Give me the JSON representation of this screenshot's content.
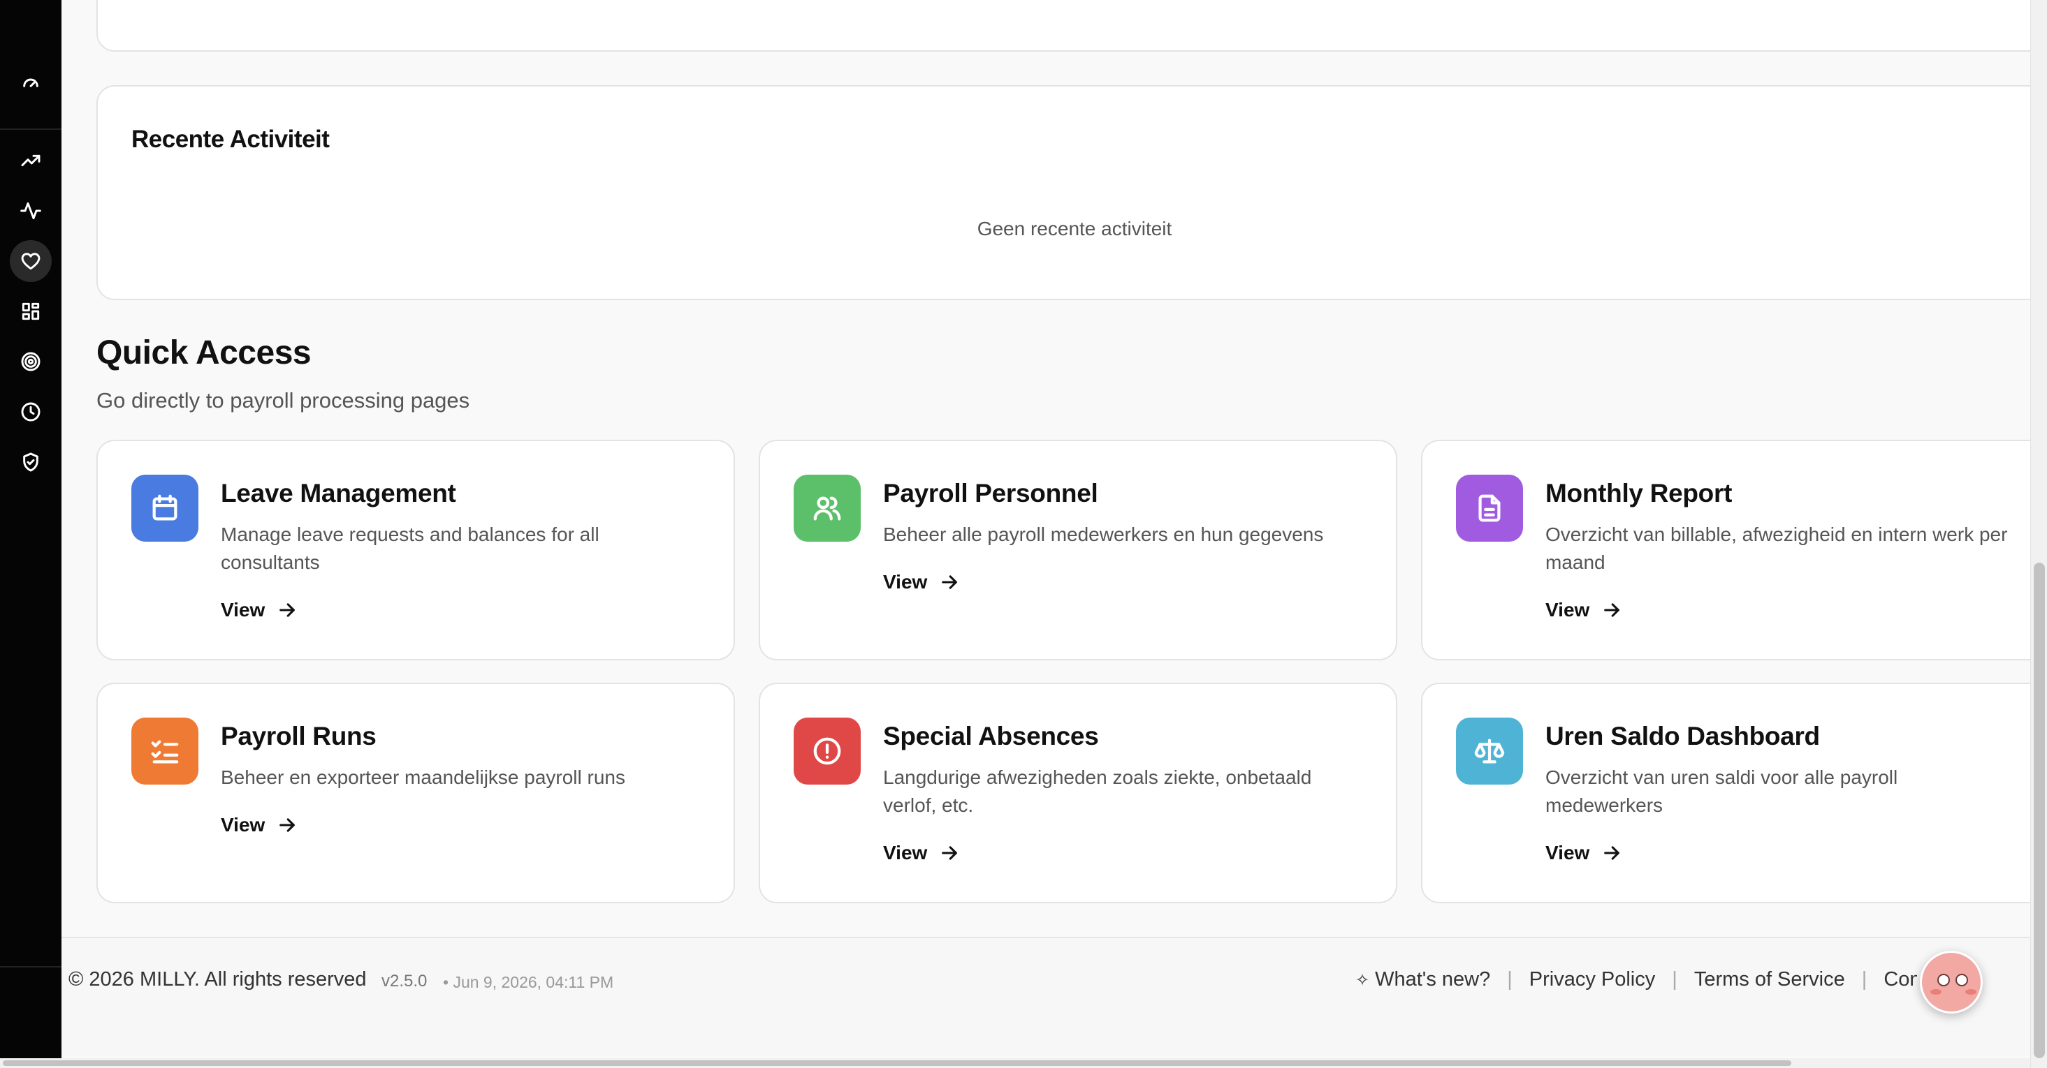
{
  "sidebar": {
    "items": [
      {
        "icon": "gauge-icon",
        "active": false
      },
      {
        "icon": "trending-up-icon",
        "active": false
      },
      {
        "icon": "activity-icon",
        "active": false
      },
      {
        "icon": "heart-icon",
        "active": true
      },
      {
        "icon": "grid-icon",
        "active": false
      },
      {
        "icon": "target-icon",
        "active": false
      },
      {
        "icon": "clock-icon",
        "active": false
      },
      {
        "icon": "shield-check-icon",
        "active": false
      }
    ]
  },
  "activity": {
    "title": "Recente Activiteit",
    "empty_text": "Geen recente activiteit"
  },
  "quick_access": {
    "title": "Quick Access",
    "subtitle": "Go directly to payroll processing pages",
    "cards": [
      {
        "title": "Leave Management",
        "description": "Manage leave requests and balances for all consultants",
        "link": "View",
        "icon": "calendar-icon",
        "color": "#4a7be0"
      },
      {
        "title": "Payroll Personnel",
        "description": "Beheer alle payroll medewerkers en hun gegevens",
        "link": "View",
        "icon": "users-icon",
        "color": "#5cbf6a"
      },
      {
        "title": "Monthly Report",
        "description": "Overzicht van billable, afwezigheid en intern werk per maand",
        "link": "View",
        "icon": "file-text-icon",
        "color": "#a05be0"
      },
      {
        "title": "Payroll Runs",
        "description": "Beheer en exporteer maandelijkse payroll runs",
        "link": "View",
        "icon": "list-checks-icon",
        "color": "#ee7a33"
      },
      {
        "title": "Special Absences",
        "description": "Langdurige afwezigheden zoals ziekte, onbetaald verlof, etc.",
        "link": "View",
        "icon": "alert-circle-icon",
        "color": "#e04848"
      },
      {
        "title": "Uren Saldo Dashboard",
        "description": "Overzicht van uren saldi voor alle payroll medewerkers",
        "link": "View",
        "icon": "scale-icon",
        "color": "#4fb3d6"
      }
    ]
  },
  "footer": {
    "copyright": "© 2026 MILLY. All rights reserved",
    "version": "v2.5.0",
    "timestamp": "• Jun 9, 2026, 04:11 PM",
    "links": {
      "whats_new": "What's new?",
      "privacy": "Privacy Policy",
      "terms": "Terms of Service",
      "contact": "Contact"
    }
  }
}
